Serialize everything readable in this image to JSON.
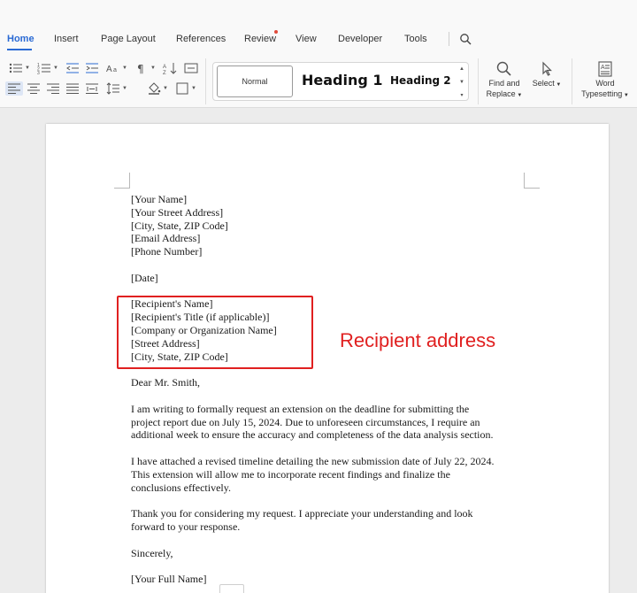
{
  "tabs": [
    {
      "label": "Home",
      "active": true
    },
    {
      "label": "Insert"
    },
    {
      "label": "Page Layout"
    },
    {
      "label": "References"
    },
    {
      "label": "Review"
    },
    {
      "label": "View"
    },
    {
      "label": "Developer"
    },
    {
      "label": "Tools"
    }
  ],
  "ribbon": {
    "styles": {
      "normal": "Normal",
      "heading1": "Heading 1",
      "heading2": "Heading 2"
    },
    "find_replace": {
      "line1": "Find and",
      "line2": "Replace"
    },
    "select": "Select",
    "word_typesetting": {
      "line1": "Word",
      "line2": "Typesetting"
    }
  },
  "colors": {
    "accent": "#2a6ad4",
    "annotation": "#e02020",
    "notification": "#e04a3a"
  },
  "document": {
    "sender": [
      "[Your Name]",
      "[Your Street Address]",
      "[City, State, ZIP Code]",
      "[Email Address]",
      "[Phone Number]"
    ],
    "date": "[Date]",
    "recipient": [
      "[Recipient's Name]",
      "[Recipient's Title (if applicable)]",
      "[Company or Organization Name]",
      "[Street Address]",
      "[City, State, ZIP Code]"
    ],
    "salutation": "Dear Mr. Smith,",
    "paragraphs": [
      [
        "I am writing to formally request an extension on the deadline for submitting the",
        "project report due on July 15, 2024. Due to unforeseen circumstances, I require an",
        "additional week to ensure the accuracy and completeness of the data analysis section."
      ],
      [
        "I have attached a revised timeline detailing the new submission date of July 22, 2024.",
        "This extension will allow me to incorporate recent findings and finalize the",
        "conclusions effectively."
      ],
      [
        "Thank you for considering my request. I appreciate your understanding and look",
        "forward to your response."
      ]
    ],
    "closing": "Sincerely,",
    "signature": "[Your Full Name]"
  },
  "annotation": {
    "label": "Recipient address"
  }
}
